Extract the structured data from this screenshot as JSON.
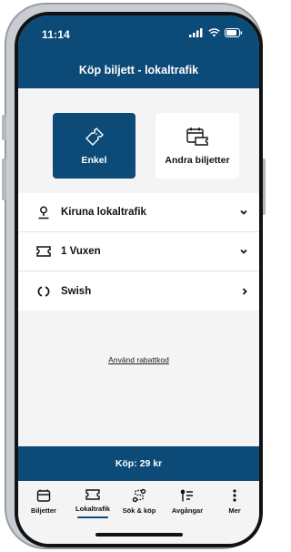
{
  "status_bar": {
    "time": "11:14"
  },
  "header": {
    "title": "Köp biljett - lokaltrafik"
  },
  "ticket_options": [
    {
      "label": "Enkel",
      "icon": "ticket-icon",
      "selected": true
    },
    {
      "label": "Andra biljetter",
      "icon": "calendar-ticket-icon",
      "selected": false
    }
  ],
  "selections": [
    {
      "label": "Kiruna lokaltrafik",
      "icon": "location-pin-icon",
      "control": "chevron-down-icon"
    },
    {
      "label": "1 Vuxen",
      "icon": "ticket-icon",
      "control": "chevron-down-icon"
    },
    {
      "label": "Swish",
      "icon": "swish-icon",
      "control": "chevron-right-icon"
    }
  ],
  "discount_link": "Använd rabattkod",
  "buy_button": "Köp: 29 kr",
  "tabs": [
    {
      "label": "Biljetter",
      "icon": "tickets-icon",
      "active": false
    },
    {
      "label": "Lokaltrafik",
      "icon": "ticket-icon",
      "active": true
    },
    {
      "label": "Sök & köp",
      "icon": "route-icon",
      "active": false
    },
    {
      "label": "Avgångar",
      "icon": "departures-icon",
      "active": false
    },
    {
      "label": "Mer",
      "icon": "more-icon",
      "active": false
    }
  ],
  "colors": {
    "brand": "#0c4a78",
    "background": "#f4f4f5",
    "card": "#ffffff",
    "text": "#111111"
  }
}
